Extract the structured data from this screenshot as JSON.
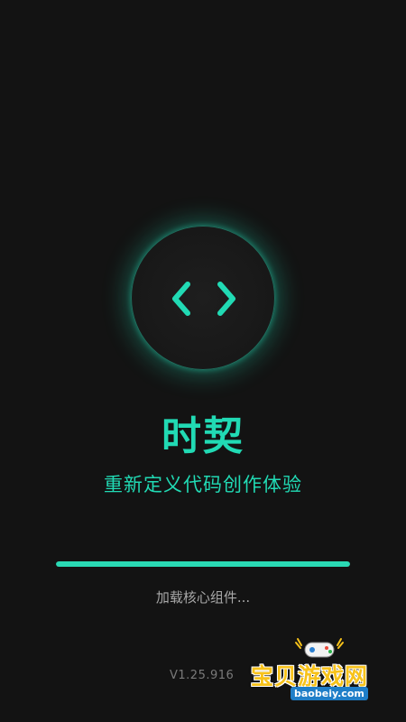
{
  "app": {
    "title": "时契",
    "subtitle": "重新定义代码创作体验",
    "logo_icon": "code-brackets-icon",
    "accent_color": "#21dab4",
    "background_color": "#131313"
  },
  "loading": {
    "status": "加载核心组件...",
    "progress_percent": 100
  },
  "version": "V1.25.916",
  "watermark": {
    "text": "宝贝游戏网",
    "url": "baobeiy.com",
    "icon": "gamepad-icon"
  }
}
